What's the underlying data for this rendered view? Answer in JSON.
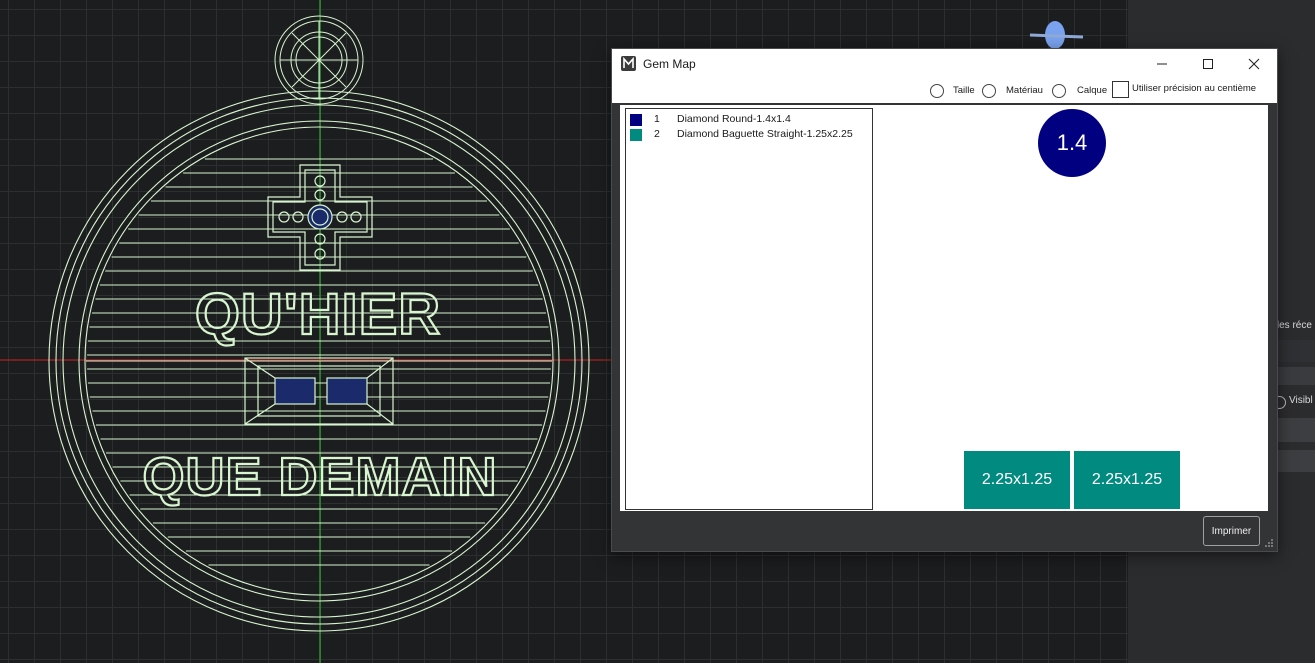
{
  "viewport": {
    "line_color": "#d7f5cf",
    "text_line_1": "QU'HIER",
    "text_line_2": "QUE DEMAIN",
    "round_gem_color": "#1a2a6b"
  },
  "side_panel": {
    "partial_label": "ndes réce",
    "visible_label": "Visibl"
  },
  "gem_map": {
    "title": "Gem Map",
    "icon": "app-logo-icon",
    "options": {
      "size_label": "Taille",
      "material_label": "Matériau",
      "layer_label": "Calque",
      "precision_label": "Utiliser précision au centième"
    },
    "gems": [
      {
        "number": "1",
        "name": "Diamond Round-1.4x1.4",
        "color": "#000080"
      },
      {
        "number": "2",
        "name": "Diamond Baguette Straight-1.25x2.25",
        "color": "#008a80"
      }
    ],
    "map": {
      "round_label": "1.4",
      "baguette_labels": [
        "2.25x1.25",
        "2.25x1.25"
      ]
    },
    "print_label": "Imprimer"
  }
}
